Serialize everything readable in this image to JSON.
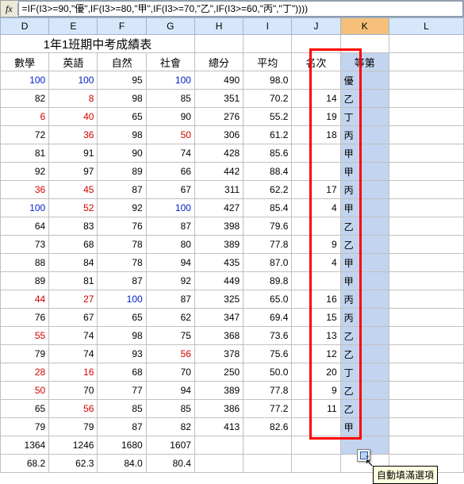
{
  "formula": "=IF(I3>=90,\"優\",IF(I3>=80,\"甲\",IF(I3>=70,\"乙\",IF(I3>=60,\"丙\",\"丁\"))))",
  "fx_label": "fx",
  "columns": [
    "D",
    "E",
    "F",
    "G",
    "H",
    "I",
    "J",
    "K",
    "L"
  ],
  "selected_col": "K",
  "title": "1年1班期中考成績表",
  "headers": [
    "數學",
    "英語",
    "自然",
    "社會",
    "總分",
    "平均",
    "名次",
    "等第"
  ],
  "rows": [
    {
      "d": {
        "v": "100",
        "c": "blue"
      },
      "e": {
        "v": "100",
        "c": "blue"
      },
      "f": {
        "v": "95"
      },
      "g": {
        "v": "100",
        "c": "blue"
      },
      "h": "490",
      "i": "98.0",
      "j": "",
      "k": "優"
    },
    {
      "d": {
        "v": "82"
      },
      "e": {
        "v": "8",
        "c": "red"
      },
      "f": {
        "v": "98"
      },
      "g": {
        "v": "85"
      },
      "h": "351",
      "i": "70.2",
      "j": "14",
      "k": "乙"
    },
    {
      "d": {
        "v": "6",
        "c": "red"
      },
      "e": {
        "v": "40",
        "c": "red"
      },
      "f": {
        "v": "65"
      },
      "g": {
        "v": "90"
      },
      "h": "276",
      "i": "55.2",
      "j": "19",
      "k": "丁"
    },
    {
      "d": {
        "v": "72"
      },
      "e": {
        "v": "36",
        "c": "red"
      },
      "f": {
        "v": "98"
      },
      "g": {
        "v": "50",
        "c": "red"
      },
      "h": "306",
      "i": "61.2",
      "j": "18",
      "k": "丙"
    },
    {
      "d": {
        "v": "81"
      },
      "e": {
        "v": "91"
      },
      "f": {
        "v": "90"
      },
      "g": {
        "v": "74"
      },
      "h": "428",
      "i": "85.6",
      "j": "",
      "k": "甲"
    },
    {
      "d": {
        "v": "92"
      },
      "e": {
        "v": "97"
      },
      "f": {
        "v": "89"
      },
      "g": {
        "v": "66"
      },
      "h": "442",
      "i": "88.4",
      "j": "",
      "k": "甲"
    },
    {
      "d": {
        "v": "36",
        "c": "red"
      },
      "e": {
        "v": "45",
        "c": "red"
      },
      "f": {
        "v": "87"
      },
      "g": {
        "v": "67"
      },
      "h": "311",
      "i": "62.2",
      "j": "17",
      "k": "丙"
    },
    {
      "d": {
        "v": "100",
        "c": "blue"
      },
      "e": {
        "v": "52",
        "c": "red"
      },
      "f": {
        "v": "92"
      },
      "g": {
        "v": "100",
        "c": "blue"
      },
      "h": "427",
      "i": "85.4",
      "j": "4",
      "k": "甲"
    },
    {
      "d": {
        "v": "64"
      },
      "e": {
        "v": "83"
      },
      "f": {
        "v": "76"
      },
      "g": {
        "v": "87"
      },
      "h": "398",
      "i": "79.6",
      "j": "",
      "k": "乙"
    },
    {
      "d": {
        "v": "73"
      },
      "e": {
        "v": "68"
      },
      "f": {
        "v": "78"
      },
      "g": {
        "v": "80"
      },
      "h": "389",
      "i": "77.8",
      "j": "9",
      "k": "乙"
    },
    {
      "d": {
        "v": "88"
      },
      "e": {
        "v": "84"
      },
      "f": {
        "v": "78"
      },
      "g": {
        "v": "94"
      },
      "h": "435",
      "i": "87.0",
      "j": "4",
      "k": "甲"
    },
    {
      "d": {
        "v": "89"
      },
      "e": {
        "v": "81"
      },
      "f": {
        "v": "87"
      },
      "g": {
        "v": "92"
      },
      "h": "449",
      "i": "89.8",
      "j": "",
      "k": "甲"
    },
    {
      "d": {
        "v": "44",
        "c": "red"
      },
      "e": {
        "v": "27",
        "c": "red"
      },
      "f": {
        "v": "100",
        "c": "blue"
      },
      "g": {
        "v": "87"
      },
      "h": "325",
      "i": "65.0",
      "j": "16",
      "k": "丙"
    },
    {
      "d": {
        "v": "76"
      },
      "e": {
        "v": "67"
      },
      "f": {
        "v": "65"
      },
      "g": {
        "v": "62"
      },
      "h": "347",
      "i": "69.4",
      "j": "15",
      "k": "丙"
    },
    {
      "d": {
        "v": "55",
        "c": "red"
      },
      "e": {
        "v": "74"
      },
      "f": {
        "v": "98"
      },
      "g": {
        "v": "75"
      },
      "h": "368",
      "i": "73.6",
      "j": "13",
      "k": "乙"
    },
    {
      "d": {
        "v": "79"
      },
      "e": {
        "v": "74"
      },
      "f": {
        "v": "93"
      },
      "g": {
        "v": "56",
        "c": "red"
      },
      "h": "378",
      "i": "75.6",
      "j": "12",
      "k": "乙"
    },
    {
      "d": {
        "v": "28",
        "c": "red"
      },
      "e": {
        "v": "16",
        "c": "red"
      },
      "f": {
        "v": "68"
      },
      "g": {
        "v": "70"
      },
      "h": "250",
      "i": "50.0",
      "j": "20",
      "k": "丁"
    },
    {
      "d": {
        "v": "50",
        "c": "red"
      },
      "e": {
        "v": "70"
      },
      "f": {
        "v": "77"
      },
      "g": {
        "v": "94"
      },
      "h": "389",
      "i": "77.8",
      "j": "9",
      "k": "乙"
    },
    {
      "d": {
        "v": "65"
      },
      "e": {
        "v": "56",
        "c": "red"
      },
      "f": {
        "v": "85"
      },
      "g": {
        "v": "85"
      },
      "h": "386",
      "i": "77.2",
      "j": "11",
      "k": "乙"
    },
    {
      "d": {
        "v": "79"
      },
      "e": {
        "v": "79"
      },
      "f": {
        "v": "87"
      },
      "g": {
        "v": "82"
      },
      "h": "413",
      "i": "82.6",
      "j": "",
      "k": "甲"
    }
  ],
  "totals": {
    "d": "1364",
    "e": "1246",
    "f": "1680",
    "g": "1607",
    "h": "",
    "i": "",
    "j": "",
    "k": ""
  },
  "averages": {
    "d": "68.2",
    "e": "62.3",
    "f": "84.0",
    "g": "80.4",
    "h": "",
    "i": "",
    "j": "",
    "k": ""
  },
  "tooltip": "自動填滿選項",
  "chart_data": null
}
